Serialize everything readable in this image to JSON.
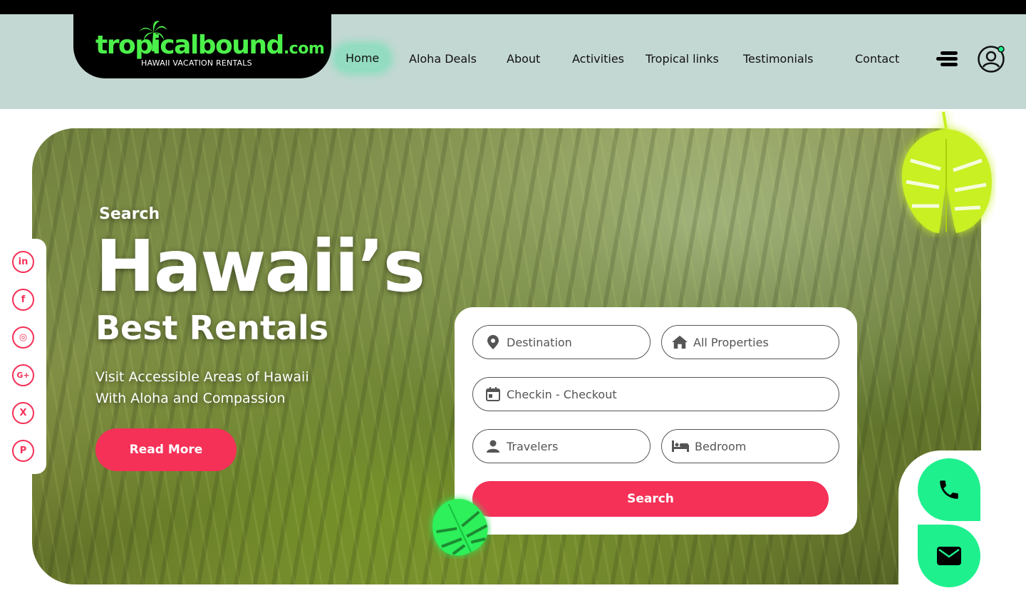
{
  "brand": {
    "logo_main": "tropicalbound",
    "logo_com": ".com",
    "logo_sub": "HAWAII VACATION RENTALS",
    "accent_green": "#4cf04a",
    "accent_pink": "#f53158",
    "contact_green": "#1ef08e"
  },
  "nav": {
    "items": [
      {
        "label": "Home",
        "active": true
      },
      {
        "label": "Aloha Deals"
      },
      {
        "label": "About"
      },
      {
        "label": "Activities"
      },
      {
        "label": "Tropical links"
      },
      {
        "label": "Testimonials"
      },
      {
        "label": "Contact"
      }
    ],
    "menu_icon": "hamburger-icon",
    "account_icon": "user-avatar-icon"
  },
  "hero": {
    "kicker": "Search",
    "title": "Hawaii’s",
    "subtitle": "Best Rentals",
    "tagline_line1": "Visit Accessible Areas of Hawaii",
    "tagline_line2": "With Aloha and Compassion",
    "cta_label": "Read More"
  },
  "social": [
    {
      "name": "linkedin-icon",
      "glyph": "in"
    },
    {
      "name": "facebook-icon",
      "glyph": "f"
    },
    {
      "name": "instagram-icon",
      "glyph": "◎"
    },
    {
      "name": "google-plus-icon",
      "glyph": "G+"
    },
    {
      "name": "x-twitter-icon",
      "glyph": "X"
    },
    {
      "name": "pinterest-icon",
      "glyph": "P"
    }
  ],
  "search_form": {
    "destination_placeholder": "Destination",
    "property_placeholder": "All Properties",
    "dates_placeholder": "Checkin - Checkout",
    "travelers_placeholder": "Travelers",
    "bedroom_placeholder": "Bedroom",
    "submit_label": "Search"
  },
  "contact": {
    "phone_icon": "phone-icon",
    "mail_icon": "mail-icon"
  }
}
